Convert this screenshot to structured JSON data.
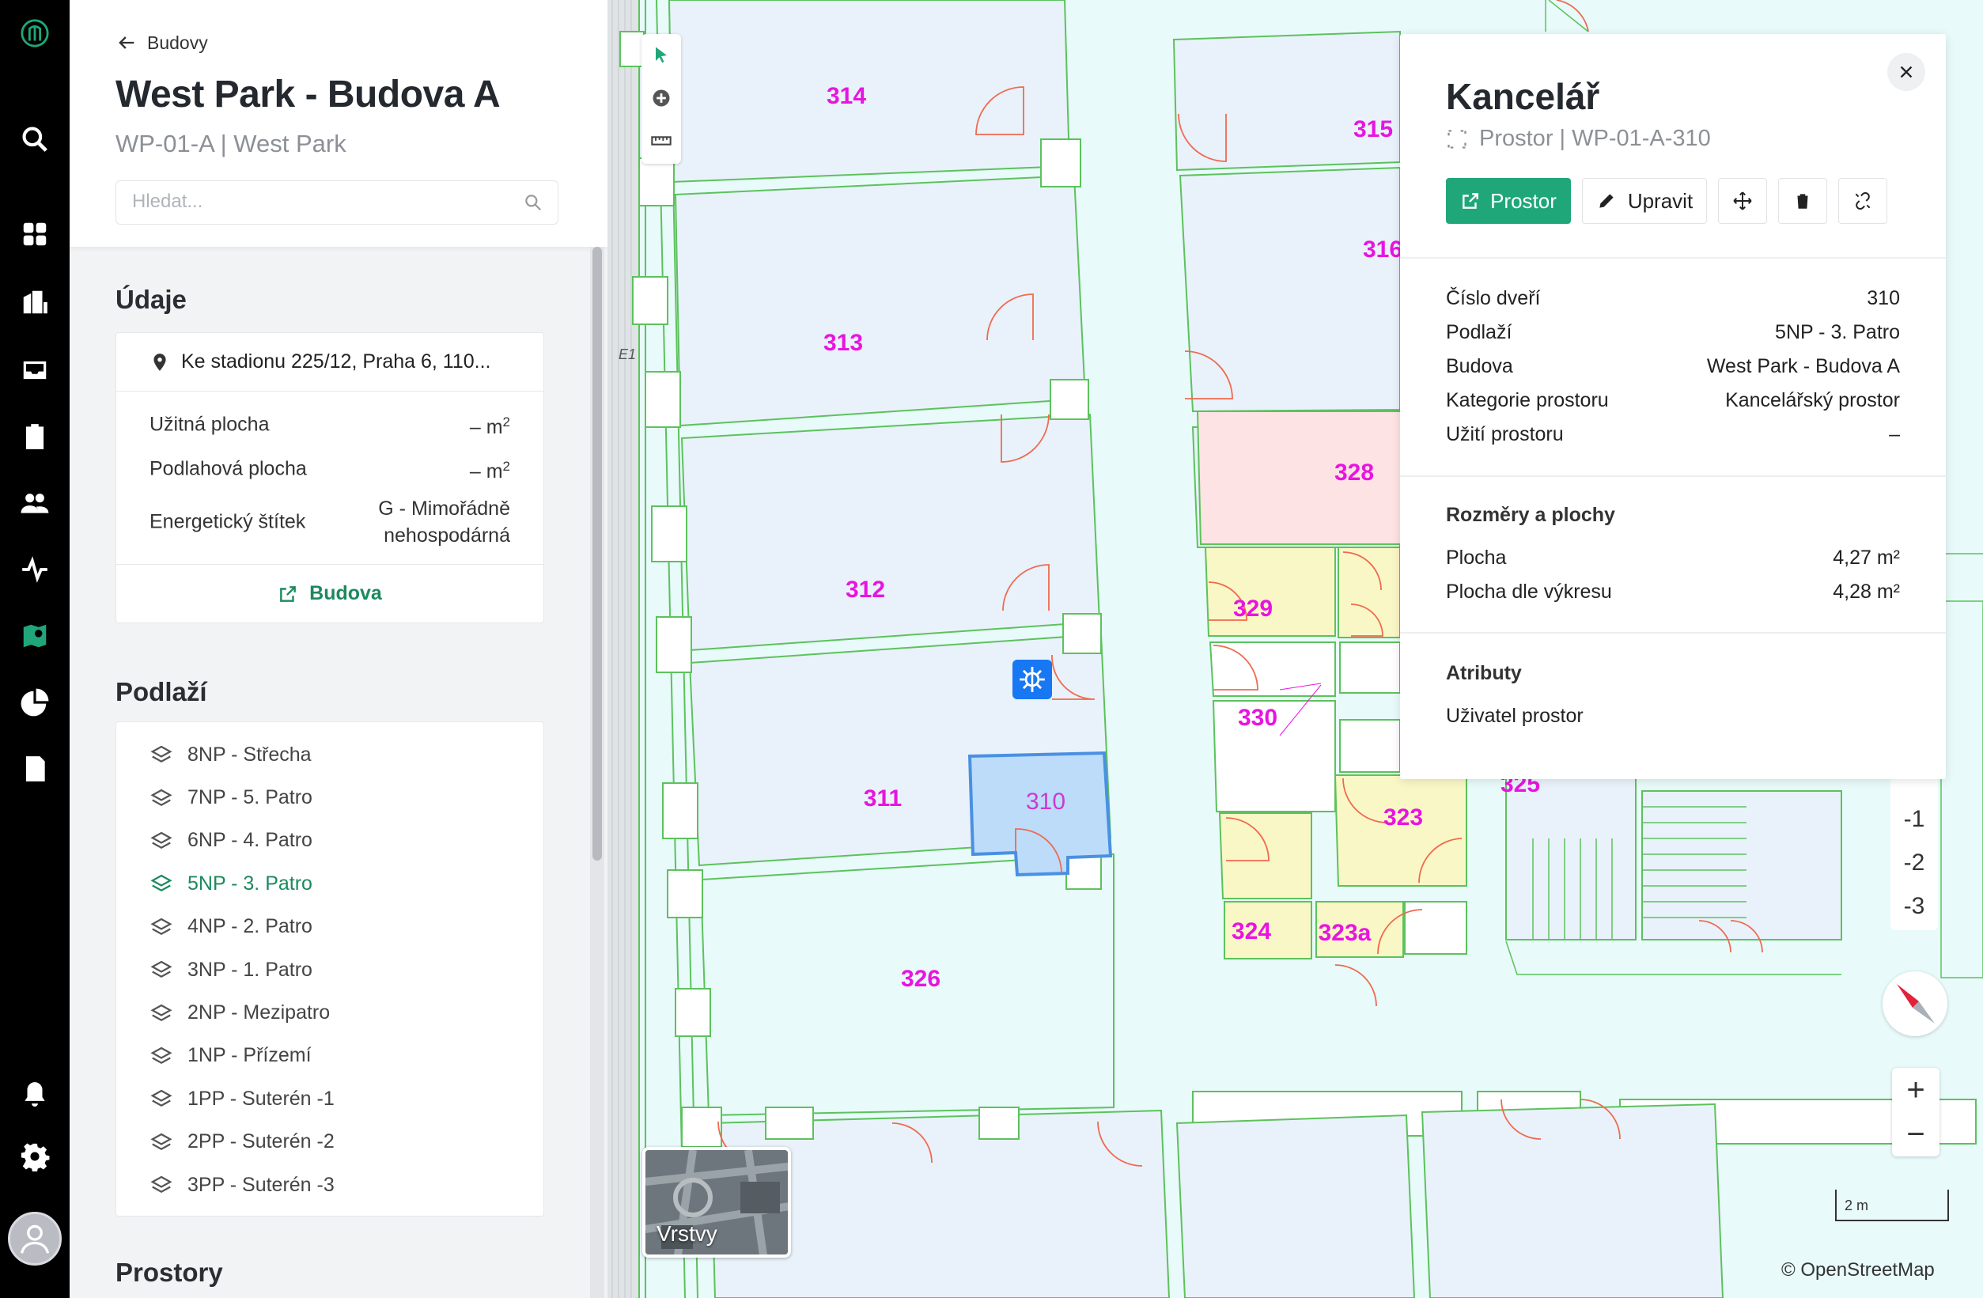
{
  "nav_rail": {
    "items": [
      {
        "name": "logo-icon"
      },
      {
        "name": "search-icon"
      },
      {
        "name": "dashboard-icon"
      },
      {
        "name": "buildings-icon"
      },
      {
        "name": "inbox-icon"
      },
      {
        "name": "clipboard-icon"
      },
      {
        "name": "users-icon"
      },
      {
        "name": "activity-icon"
      },
      {
        "name": "map-pin-icon"
      },
      {
        "name": "pie-chart-icon"
      },
      {
        "name": "reports-icon"
      },
      {
        "name": "bell-icon"
      },
      {
        "name": "settings-icon"
      },
      {
        "name": "user-avatar-icon"
      }
    ],
    "active": "map-pin-icon"
  },
  "sidebar": {
    "back_label": "Budovy",
    "title": "West Park - Budova A",
    "subtitle": "WP-01-A | West Park",
    "search_placeholder": "Hledat...",
    "details": {
      "heading": "Údaje",
      "address": "Ke stadionu 225/12, Praha 6, 110...",
      "rows": [
        {
          "label": "Užitná plocha",
          "value": "– m",
          "unit_sup": "2"
        },
        {
          "label": "Podlahová plocha",
          "value": "– m",
          "unit_sup": "2"
        },
        {
          "label": "Energetický štítek",
          "value_line1": "G - Mimořádně",
          "value_line2": "nehospodárná"
        }
      ],
      "link_label": "Budova"
    },
    "floors": {
      "heading": "Podlaží",
      "items": [
        "8NP - Střecha",
        "7NP - 5. Patro",
        "6NP - 4. Patro",
        "5NP - 3. Patro",
        "4NP - 2. Patro",
        "3NP - 1. Patro",
        "2NP - Mezipatro",
        "1NP - Přízemí",
        "1PP - Suterén -1",
        "2PP - Suterén -2",
        "3PP - Suterén -3"
      ],
      "active": "5NP - 3. Patro"
    },
    "spaces_heading": "Prostory"
  },
  "map": {
    "rooms": [
      "314",
      "313",
      "312",
      "311",
      "310",
      "326",
      "315",
      "316",
      "328",
      "329",
      "330",
      "323",
      "324",
      "323a",
      "325"
    ],
    "selected_room": "310",
    "e1_label": "E1",
    "layers_label": "Vrstvy",
    "floor_buttons": [
      "-1",
      "-2",
      "-3"
    ],
    "zoom_in": "+",
    "zoom_out": "−",
    "scale_label": "2 m",
    "attribution": "© OpenStreetMap",
    "colors": {
      "background": "#e8fafa",
      "wall": "#5cc25c",
      "door": "#f06a50",
      "room_label": "#e814e0",
      "selected_fill": "#bcdcfa",
      "selected_stroke": "#4a90e2",
      "room_pink": "#fde3e3",
      "room_yellow": "#faf7c6"
    }
  },
  "detail_panel": {
    "title": "Kancelář",
    "subtitle": "Prostor | WP-01-A-310",
    "actions": {
      "primary": "Prostor",
      "edit": "Upravit"
    },
    "info_rows": [
      {
        "label": "Číslo dveří",
        "value": "310"
      },
      {
        "label": "Podlaží",
        "value": "5NP - 3. Patro"
      },
      {
        "label": "Budova",
        "value": "West Park - Budova A"
      },
      {
        "label": "Kategorie prostoru",
        "value": "Kancelářský prostor"
      },
      {
        "label": "Užití prostoru",
        "value": "–"
      }
    ],
    "dimensions": {
      "heading": "Rozměry a plochy",
      "rows": [
        {
          "label": "Plocha",
          "value": "4,27 m²"
        },
        {
          "label": "Plocha dle výkresu",
          "value": "4,28 m²"
        }
      ]
    },
    "attributes": {
      "heading": "Atributy",
      "rows": [
        {
          "label": "Uživatel prostor"
        }
      ]
    },
    "colors": {
      "primary": "#1fa779"
    }
  }
}
